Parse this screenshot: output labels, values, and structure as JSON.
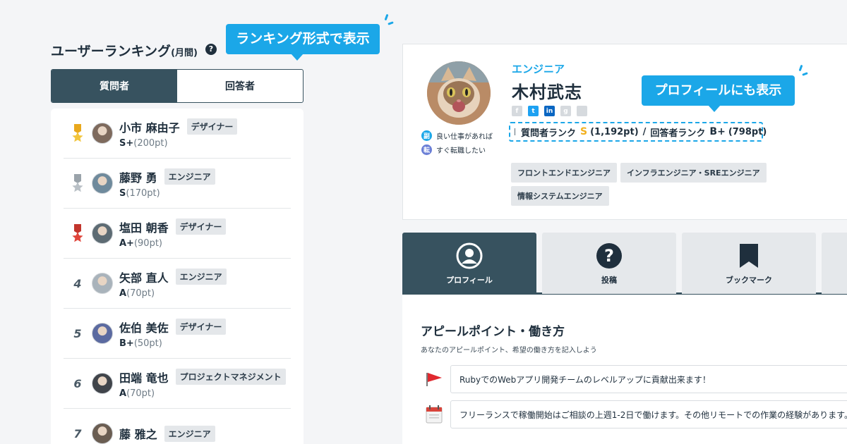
{
  "ranking": {
    "title": "ユーザーランキング",
    "title_suffix": "(月間)",
    "help_icon": "?",
    "callout": "ランキング形式で表示",
    "tabs": [
      "質問者",
      "回答者"
    ],
    "users": [
      {
        "rank": "1",
        "medal": "gold",
        "name": "小市 麻由子",
        "tag": "デザイナー",
        "grade": "S+",
        "points": "(200pt)"
      },
      {
        "rank": "2",
        "medal": "silver",
        "name": "藤野 勇",
        "tag": "エンジニア",
        "grade": "S",
        "points": "(170pt)"
      },
      {
        "rank": "3",
        "medal": "bronze",
        "name": "塩田 朝香",
        "tag": "デザイナー",
        "grade": "A+",
        "points": "(90pt)"
      },
      {
        "rank": "4",
        "medal": "",
        "name": "矢部 直人",
        "tag": "エンジニア",
        "grade": "A",
        "points": "(70pt)"
      },
      {
        "rank": "5",
        "medal": "",
        "name": "佐伯 美佐",
        "tag": "デザイナー",
        "grade": "B+",
        "points": "(50pt)"
      },
      {
        "rank": "6",
        "medal": "",
        "name": "田端 竜也",
        "tag": "プロジェクトマネジメント",
        "grade": "A",
        "points": "(70pt)"
      },
      {
        "rank": "7",
        "medal": "",
        "name": "藤 雅之",
        "tag": "エンジニア",
        "grade": "",
        "points": ""
      }
    ]
  },
  "profile": {
    "callout": "プロフィールにも表示",
    "role": "エンジニア",
    "name": "木村武志",
    "status": [
      {
        "badge": "副",
        "text": "良い仕事があれば",
        "color": "#1ba7e8"
      },
      {
        "badge": "転",
        "text": "すぐ転職したい",
        "color": "#6b7fd6"
      }
    ],
    "rank_summary": {
      "asker_label": "質問者ランク",
      "asker_grade": "S",
      "asker_points": "(1,192pt)",
      "separator": "/",
      "answerer_label": "回答者ランク",
      "answerer_grade": "B+",
      "answerer_points": "(798pt)"
    },
    "skills": [
      "フロントエンドエンジニア",
      "インフラエンジニア・SREエンジニア",
      "情報システムエンジニア"
    ]
  },
  "tabs": [
    {
      "label": "プロフィール",
      "icon": "user-icon",
      "active": true
    },
    {
      "label": "投稿",
      "icon": "question-icon",
      "active": false
    },
    {
      "label": "ブックマーク",
      "icon": "bookmark-icon",
      "active": false
    }
  ],
  "appeal": {
    "title": "アピールポイント・働き方",
    "subtitle": "あなたのアピールポイント、希望の働き方を記入しよう",
    "items": [
      {
        "icon": "flag-icon",
        "text": "RubyでのWebアプリ開発チームのレベルアップに貢献出来ます！"
      },
      {
        "icon": "calendar-icon",
        "text": "フリーランスで稼働開始はご相談の上週1-2日で働けます。その他リモートでの作業の経験があります。"
      }
    ]
  },
  "colors": {
    "accent": "#1ba7e8",
    "dark": "#37525f",
    "gold": "#f2b01e"
  }
}
